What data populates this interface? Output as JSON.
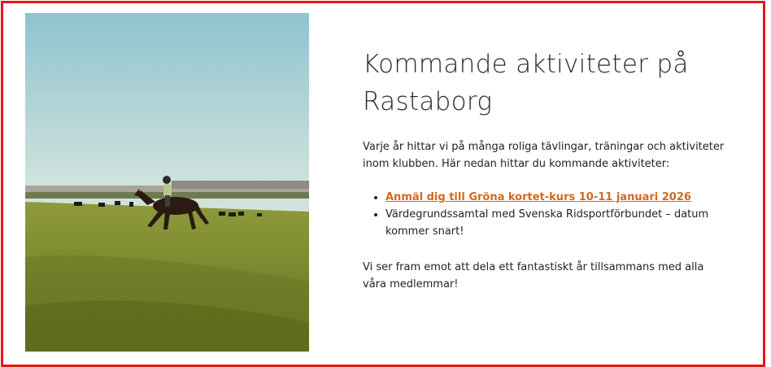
{
  "section": {
    "title": "Kommande aktiviteter på Rastaborg",
    "intro": "Varje år hittar vi på många roliga tävlingar, träningar och aktiviteter inom klubben. Här nedan hittar du kommande aktiviteter:",
    "activities": [
      {
        "text": "Anmäl dig till Gröna kortet-kurs 10-11 januari 2026",
        "is_link": true
      },
      {
        "text": "Värdegrundssamtal med Svenska Ridsportförbundet – datum kommer snart!",
        "is_link": false
      }
    ],
    "outro": "Vi ser fram emot att dela ett fantastiskt år tillsammans med alla våra medlemmar!"
  },
  "image": {
    "subject": "rider-on-horse-in-field-photo"
  },
  "colors": {
    "border": "#e01919",
    "link": "#d2691e",
    "text": "#222222"
  }
}
